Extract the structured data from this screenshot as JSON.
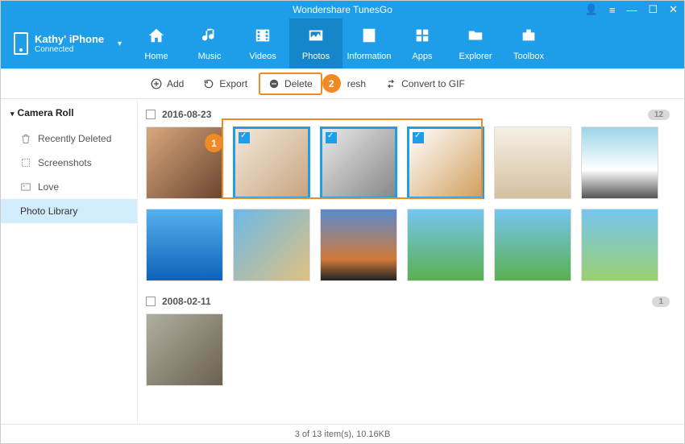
{
  "app_title": "Wondershare TunesGo",
  "device": {
    "name": "Kathy' iPhone",
    "status": "Connected"
  },
  "nav": {
    "home": "Home",
    "music": "Music",
    "videos": "Videos",
    "photos": "Photos",
    "information": "Information",
    "apps": "Apps",
    "explorer": "Explorer",
    "toolbox": "Toolbox"
  },
  "toolbar": {
    "add": "Add",
    "export": "Export",
    "delete": "Delete",
    "refresh_partial": "resh",
    "gif": "Convert to GIF"
  },
  "callouts": {
    "step1": "1",
    "step2": "2"
  },
  "sidebar": {
    "head": "Camera Roll",
    "items": [
      {
        "label": "Recently Deleted"
      },
      {
        "label": "Screenshots"
      },
      {
        "label": "Love"
      },
      {
        "label": "Photo Library"
      }
    ]
  },
  "groups": [
    {
      "date": "2016-08-23",
      "count": "12"
    },
    {
      "date": "2008-02-11",
      "count": "1"
    }
  ],
  "status": "3 of 13 item(s), 10.16KB"
}
